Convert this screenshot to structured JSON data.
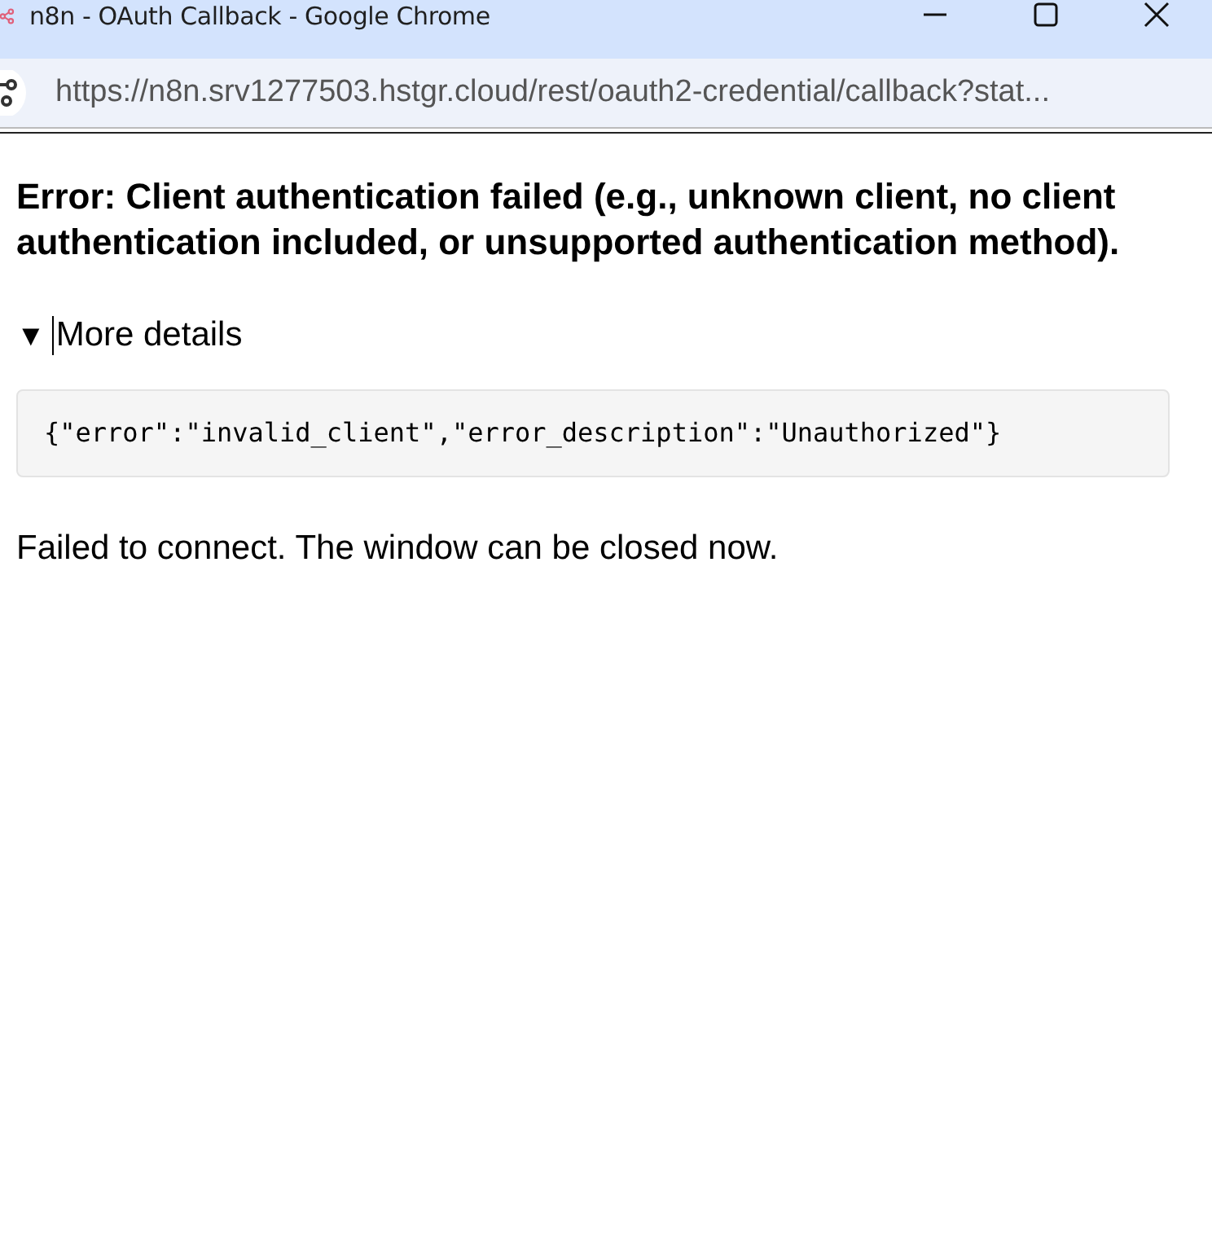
{
  "window": {
    "title": "n8n - OAuth Callback - Google Chrome"
  },
  "address_bar": {
    "url": "https://n8n.srv1277503.hstgr.cloud/rest/oauth2-credential/callback?stat..."
  },
  "page": {
    "heading": "Error: Client authentication failed (e.g., unknown client, no client authentication included, or unsupported authentication method).",
    "details": {
      "marker": "▼",
      "summary": "More details",
      "expanded": true,
      "code": "{\"error\":\"invalid_client\",\"error_description\":\"Unauthorized\"}"
    },
    "message": "Failed to connect. The window can be closed now."
  }
}
